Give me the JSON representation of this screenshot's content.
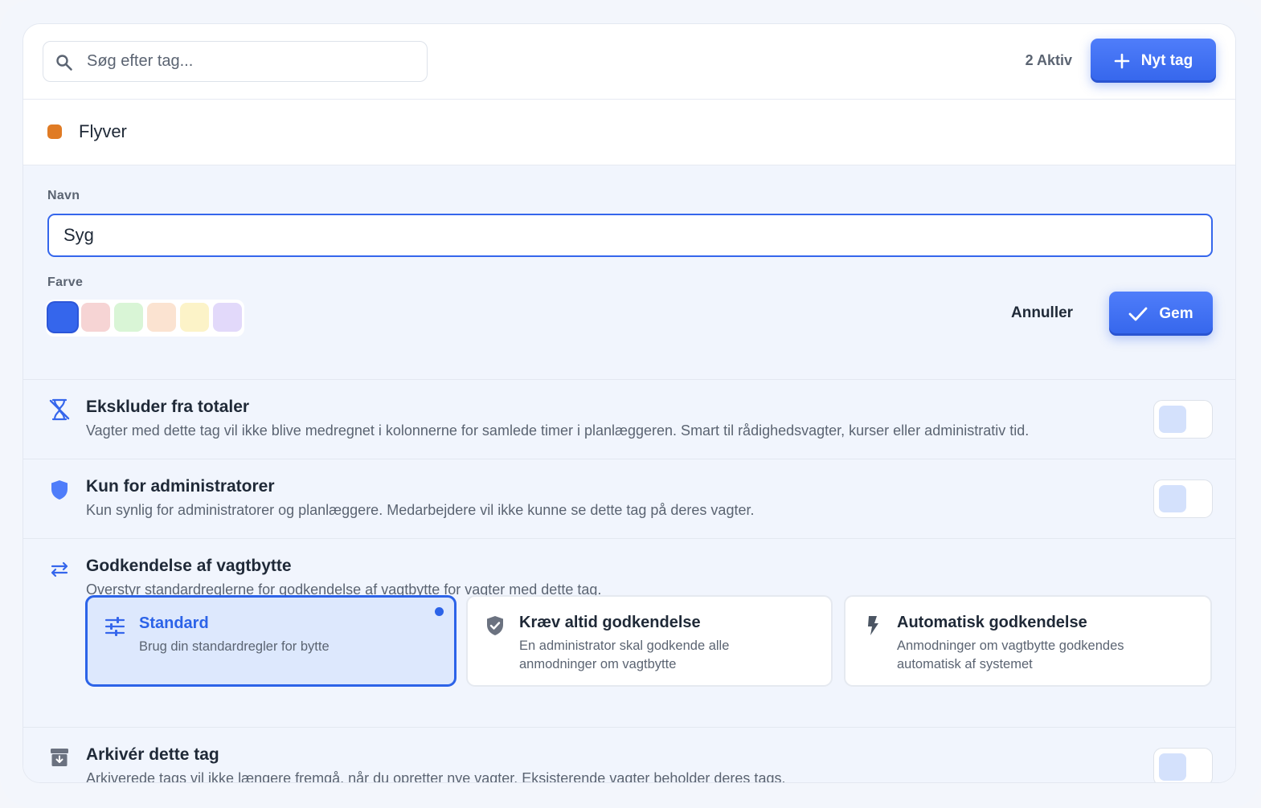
{
  "search": {
    "placeholder": "Søg efter tag...",
    "value": ""
  },
  "header": {
    "active_count": "2 Aktiv",
    "new_tag_label": "Nyt tag"
  },
  "tag": {
    "name": "Flyver",
    "color": "#e07b24"
  },
  "form": {
    "name_label": "Navn",
    "name_value": "Syg",
    "color_label": "Farve",
    "colors": [
      "#3566ec",
      "#f6d4d4",
      "#d9f5d6",
      "#fbe3d1",
      "#fcf3c8",
      "#e2d9fa"
    ],
    "selected_color_index": 0,
    "cancel_label": "Annuller",
    "save_label": "Gem"
  },
  "settings": {
    "exclude": {
      "title": "Ekskluder fra totaler",
      "desc": "Vagter med dette tag vil ikke blive medregnet i kolonnerne for samlede timer i planlæggeren. Smart til rådighedsvagter, kurser eller administrativ tid.",
      "icon": "hourglass-off-icon",
      "enabled": false
    },
    "admin_only": {
      "title": "Kun for administratorer",
      "desc": "Kun synlig for administratorer og planlæggere. Medarbejdere vil ikke kunne se dette tag på deres vagter.",
      "icon": "shield-icon",
      "enabled": false
    },
    "swap": {
      "title": "Godkendelse af vagtbytte",
      "desc": "Overstyr standardreglerne for godkendelse af vagtbytte for vagter med dette tag.",
      "icon": "swap-arrows-icon",
      "options": [
        {
          "title": "Standard",
          "desc": "Brug din standardregler for bytte",
          "icon": "sliders-icon",
          "selected": true
        },
        {
          "title": "Kræv altid godkendelse",
          "desc": "En administrator skal godkende alle anmodninger om vagtbytte",
          "icon": "shield-check-icon",
          "selected": false
        },
        {
          "title": "Automatisk godkendelse",
          "desc": "Anmodninger om vagtbytte godkendes automatisk af systemet",
          "icon": "bolt-icon",
          "selected": false
        }
      ]
    },
    "archive": {
      "title": "Arkivér dette tag",
      "desc": "Arkiverede tags vil ikke længere fremgå, når du opretter nye vagter. Eksisterende vagter beholder deres tags.",
      "icon": "archive-icon",
      "enabled": false
    }
  },
  "colors": {
    "accent": "#3566ec",
    "muted_text": "#5b6472",
    "panel_bg": "#f1f5fd"
  }
}
